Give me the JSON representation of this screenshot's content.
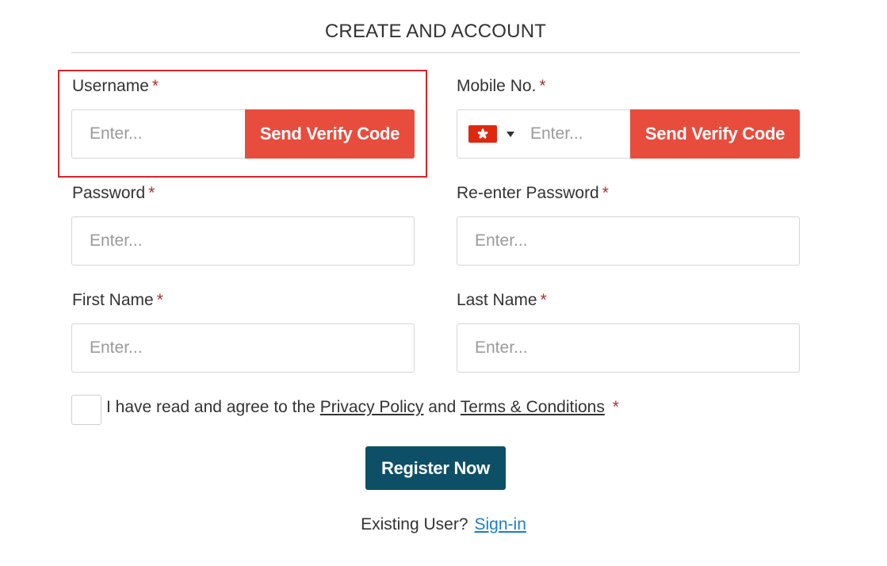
{
  "page": {
    "title": "CREATE AND ACCOUNT"
  },
  "form": {
    "username": {
      "label": "Username",
      "required_mark": "*",
      "placeholder": "Enter...",
      "button_label": "Send Verify Code"
    },
    "mobile": {
      "label": "Mobile No.",
      "required_mark": "*",
      "country_flag_icon": "hong-kong-flag-icon",
      "placeholder": "Enter...",
      "button_label": "Send Verify Code"
    },
    "password": {
      "label": "Password",
      "required_mark": "*",
      "placeholder": "Enter..."
    },
    "reenter_password": {
      "label": "Re-enter Password",
      "required_mark": "*",
      "placeholder": "Enter..."
    },
    "first_name": {
      "label": "First Name",
      "required_mark": "*",
      "placeholder": "Enter..."
    },
    "last_name": {
      "label": "Last Name",
      "required_mark": "*",
      "placeholder": "Enter..."
    },
    "agreement": {
      "prefix": "I have read and agree to the",
      "privacy_link": "Privacy Policy",
      "conjunction": "and",
      "terms_link": "Terms & Conditions",
      "required_mark": "*",
      "checked": false
    },
    "register_button": "Register Now",
    "existing_user": {
      "text": "Existing User?",
      "link": "Sign-in"
    }
  },
  "colors": {
    "verify_button": "#e84c3d",
    "register_button": "#0d4f66",
    "link": "#1a7fc4",
    "highlight": "#d9252a",
    "required": "#a83232"
  }
}
